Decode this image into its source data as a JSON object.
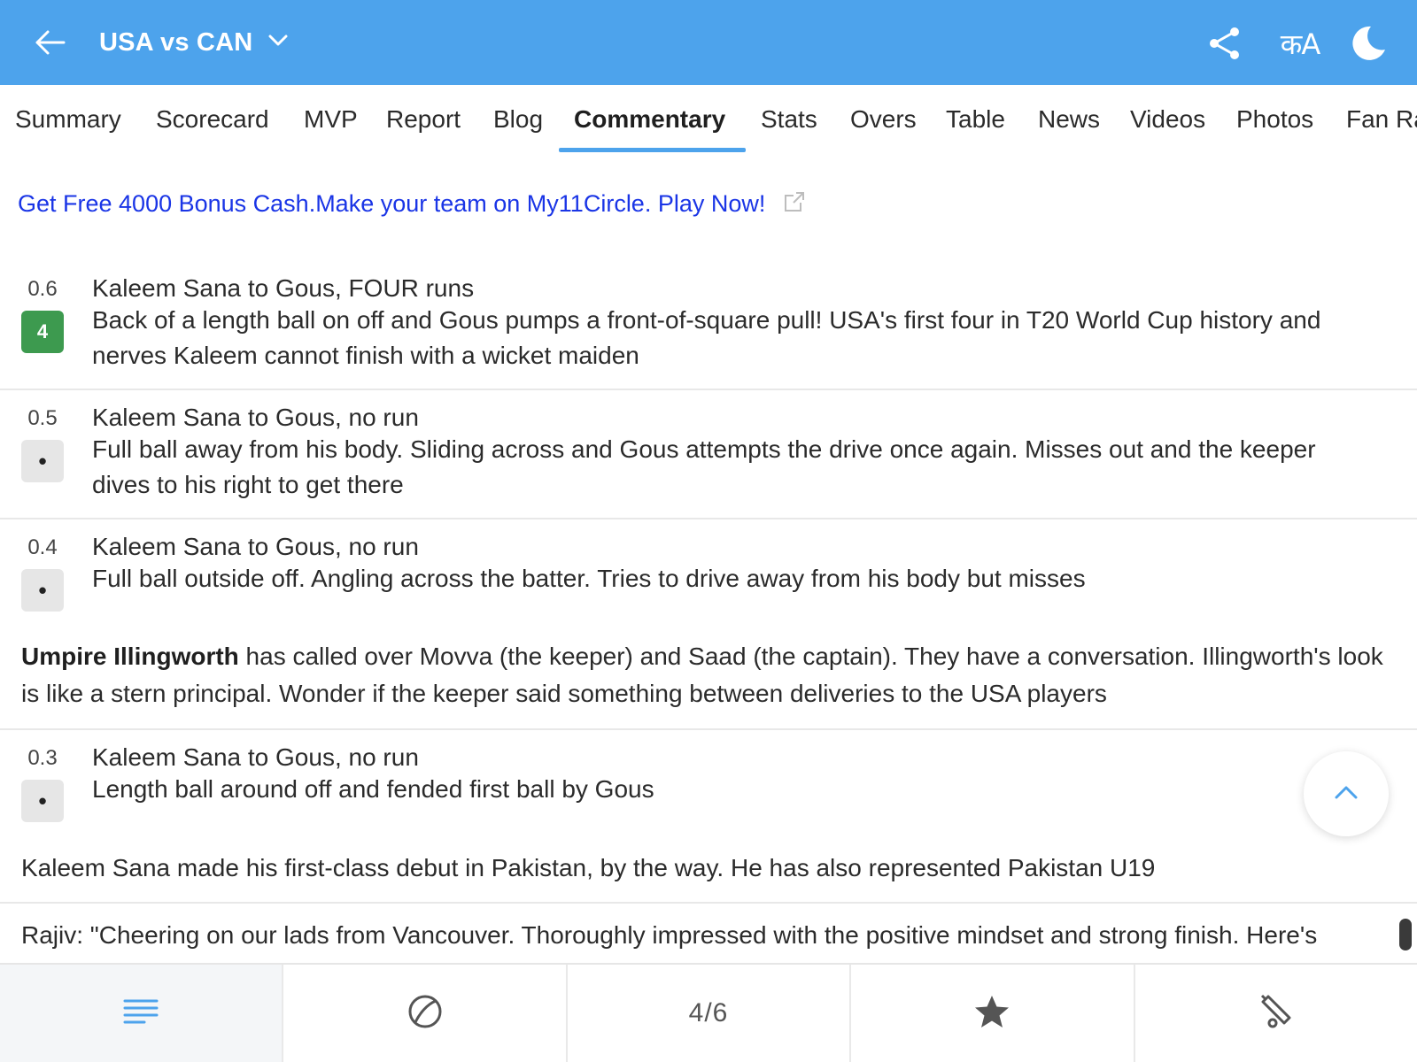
{
  "header": {
    "title": "USA vs CAN",
    "lang_label": "कA",
    "icons": [
      "back-arrow-icon",
      "chevron-down-icon",
      "share-icon",
      "language-icon",
      "moon-icon"
    ]
  },
  "tabs": [
    "Summary",
    "Scorecard",
    "MVP",
    "Report",
    "Blog",
    "Commentary",
    "Stats",
    "Overs",
    "Table",
    "News",
    "Videos",
    "Photos",
    "Fan Ra"
  ],
  "active_tab": "Commentary",
  "ad": {
    "text": "Get Free 4000 Bonus Cash.Make your team on My11Circle. Play Now!",
    "icon": "external-link-icon"
  },
  "commentary": {
    "b06": {
      "over": "0.6",
      "badge": "4",
      "title": "Kaleem Sana to Gous, FOUR runs",
      "desc": "Back of a length ball on off and Gous pumps a front-of-square pull! USA's first four in T20 World Cup history and nerves Kaleem cannot finish with a wicket maiden"
    },
    "b05": {
      "over": "0.5",
      "badge": "•",
      "title": "Kaleem Sana to Gous, no run",
      "desc": "Full ball away from his body. Sliding across and Gous attempts the drive once again. Misses out and the keeper dives to his right to get there"
    },
    "b04": {
      "over": "0.4",
      "badge": "•",
      "title": "Kaleem Sana to Gous, no run",
      "desc": "Full ball outside off. Angling across the batter. Tries to drive away from his body but misses"
    },
    "note1": {
      "bold": "Umpire Illingworth",
      "text": " has called over Movva (the keeper) and Saad (the captain). They have a conversation. Illingworth's look is like a stern principal. Wonder if the keeper said something between deliveries to the USA players"
    },
    "b03": {
      "over": "0.3",
      "badge": "•",
      "title": "Kaleem Sana to Gous, no run",
      "desc": "Length ball around off and fended first ball by Gous"
    },
    "note2": {
      "text": "Kaleem Sana made his first-class debut in Pakistan, by the way. He has also represented Pakistan U19"
    },
    "note3": {
      "text": "Rajiv: \"Cheering on our lads from Vancouver. Thoroughly impressed with the positive mindset and strong finish. Here's"
    }
  },
  "bottom_nav": {
    "counter": "4/6",
    "icons": [
      "menu-lines-icon",
      "ball-icon",
      "star-icon",
      "cricket-bat-icon"
    ]
  },
  "colors": {
    "header_bg": "#4da3ec",
    "accent": "#4da3ec",
    "four_badge": "#3d9a4f",
    "ad_link": "#1a35e6"
  }
}
